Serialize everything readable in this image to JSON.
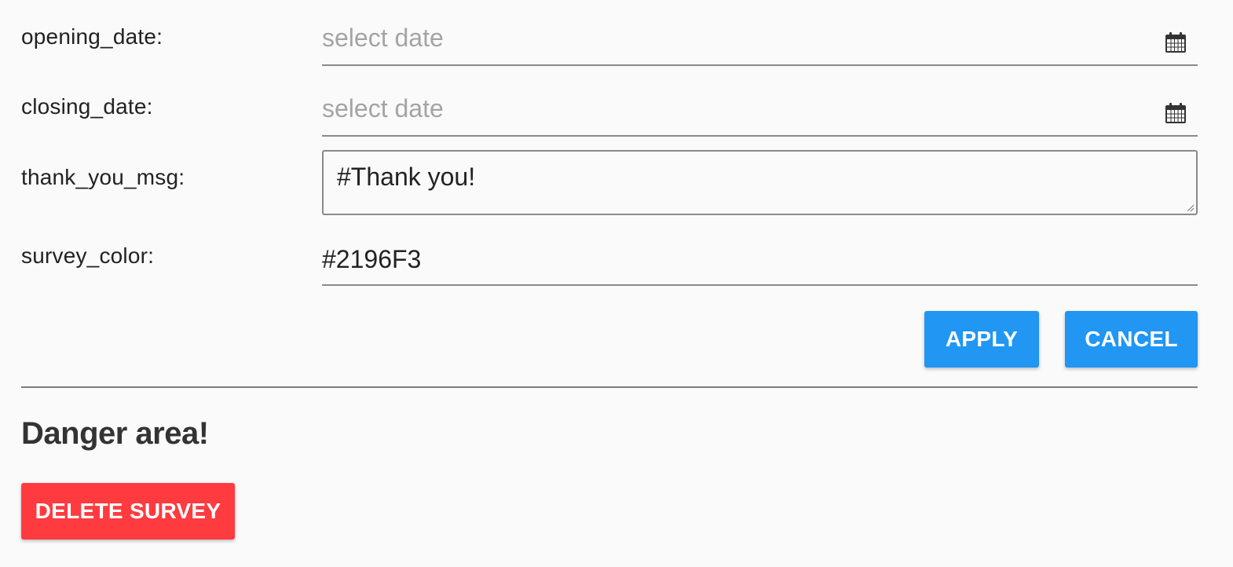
{
  "form": {
    "opening_date": {
      "label": "opening_date:",
      "placeholder": "select date",
      "icon": "calendar-icon"
    },
    "closing_date": {
      "label": "closing_date:",
      "placeholder": "select date",
      "icon": "calendar-icon"
    },
    "thank_you_msg": {
      "label": "thank_you_msg:",
      "value": "#Thank you!"
    },
    "survey_color": {
      "label": "survey_color:",
      "value": "#2196F3"
    }
  },
  "actions": {
    "apply_label": "APPLY",
    "cancel_label": "CANCEL"
  },
  "danger": {
    "title": "Danger area!",
    "delete_label": "DELETE SURVEY"
  },
  "colors": {
    "primary": "#2196F3",
    "danger": "#FF3B3F",
    "background": "#FAFAFA"
  }
}
